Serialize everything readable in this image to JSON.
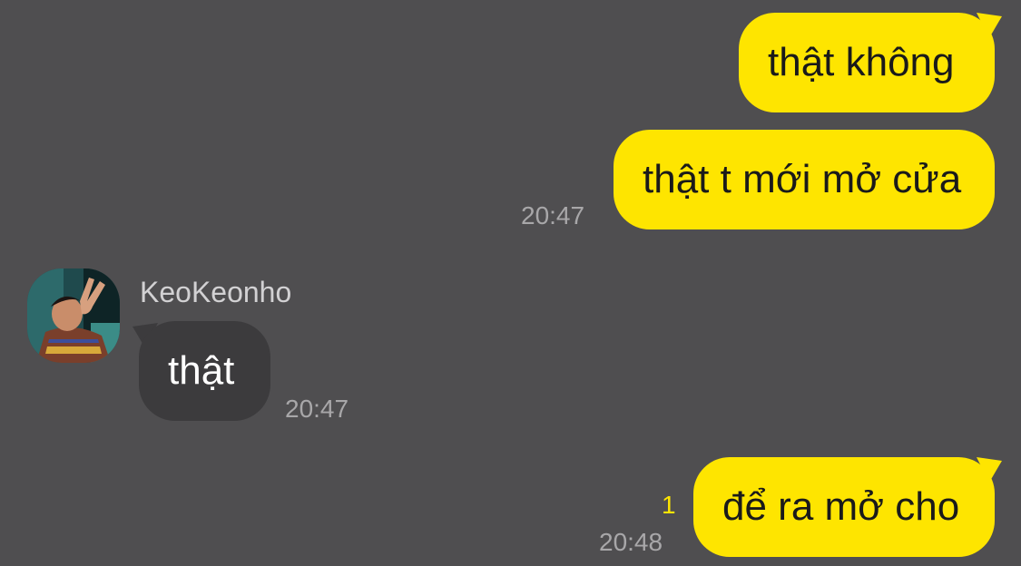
{
  "messages": [
    {
      "text": "thật không",
      "sender": "me"
    },
    {
      "text": "thật t mới mở cửa",
      "sender": "me",
      "time": "20:47"
    },
    {
      "sender_name": "KeoKeonho",
      "text": "thật",
      "sender": "other",
      "time": "20:47"
    },
    {
      "text": "để ra mở cho",
      "sender": "me",
      "time": "20:48",
      "unread_count": "1"
    }
  ],
  "colors": {
    "background": "#4f4e50",
    "my_bubble": "#fee500",
    "their_bubble": "#3c3b3d",
    "unread": "#fee500"
  }
}
